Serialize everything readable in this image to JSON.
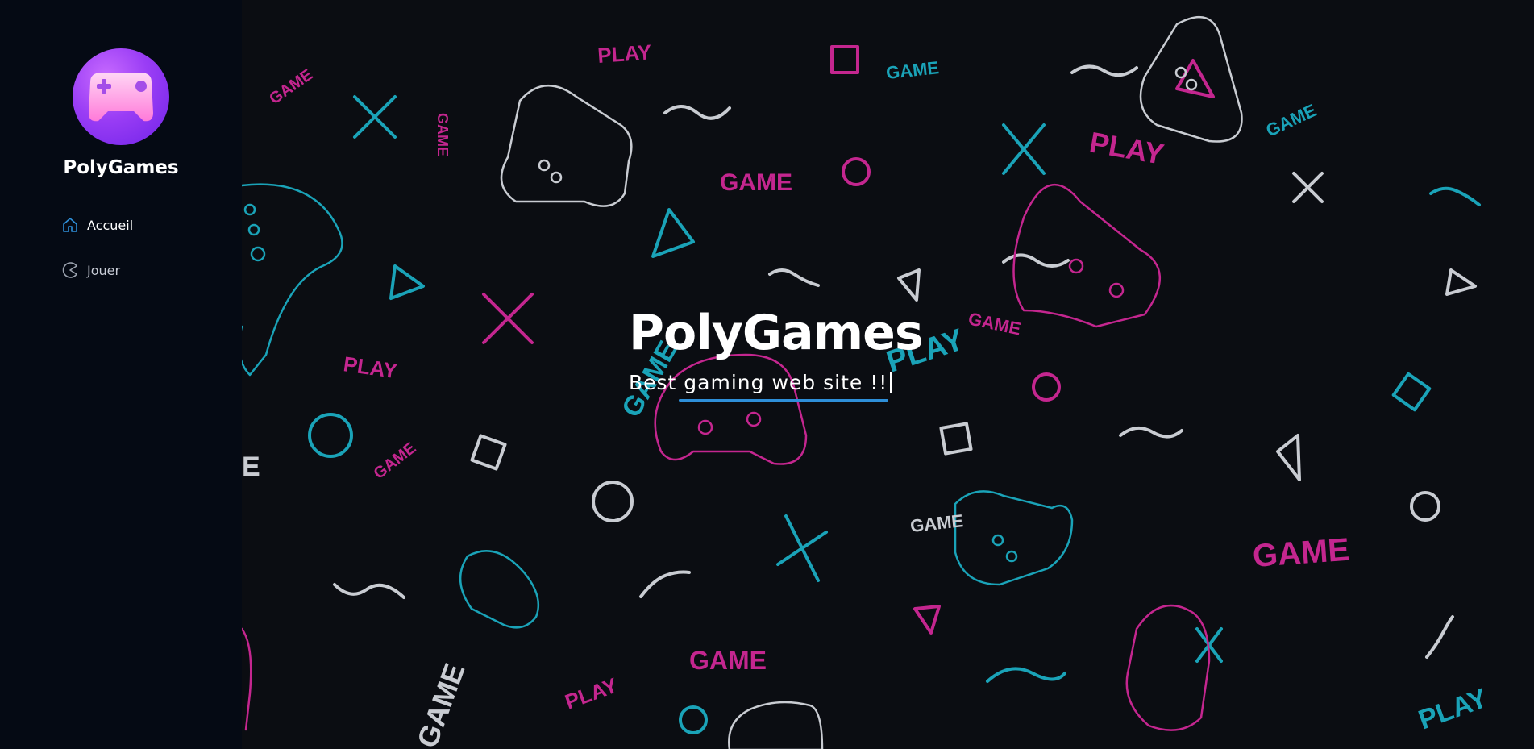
{
  "sidebar": {
    "brand": "PolyGames",
    "items": [
      {
        "label": "Accueil",
        "icon": "home-icon",
        "active": true
      },
      {
        "label": "Jouer",
        "icon": "pacman-icon",
        "active": false
      }
    ]
  },
  "hero": {
    "title": "PolyGames",
    "subtitle": "Best gaming web site !!"
  },
  "colors": {
    "sidebar_bg": "#050a14",
    "hero_bg": "#0b0d12",
    "accent_blue": "#2e8fd9",
    "pattern_pink": "#c4268f",
    "pattern_cyan": "#1aa3b8",
    "pattern_grey": "#c9ccd2",
    "logo_gradient": [
      "#c86bff",
      "#6f22e8"
    ]
  }
}
